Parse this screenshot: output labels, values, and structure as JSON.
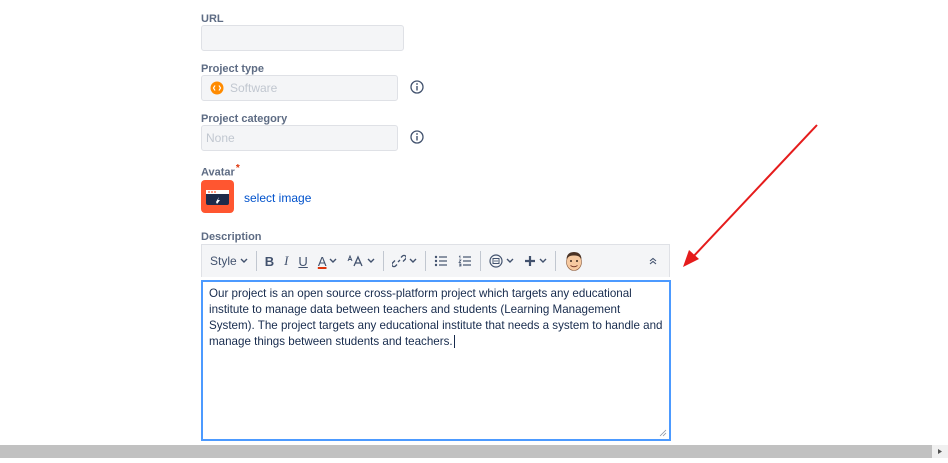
{
  "url": {
    "label": "URL",
    "value": ""
  },
  "project_type": {
    "label": "Project type",
    "value": "Software"
  },
  "project_category": {
    "label": "Project category",
    "value": "None"
  },
  "avatar": {
    "label": "Avatar",
    "required_mark": "*",
    "select_label": "select image"
  },
  "description": {
    "label": "Description",
    "toolbar": {
      "style_label": "Style",
      "bold": "B",
      "italic": "I",
      "underline": "U",
      "text_color": "A"
    },
    "text": "Our project is an open source cross-platform project which targets any educational institute to manage data between teachers and students (Learning Management System). The project targets any educational institute that needs a system to handle and manage things between students and teachers."
  },
  "colors": {
    "accent": "#4c9aff",
    "link": "#0052cc",
    "avatar_bg": "#ff5630",
    "arrow": "#e51c1c"
  }
}
